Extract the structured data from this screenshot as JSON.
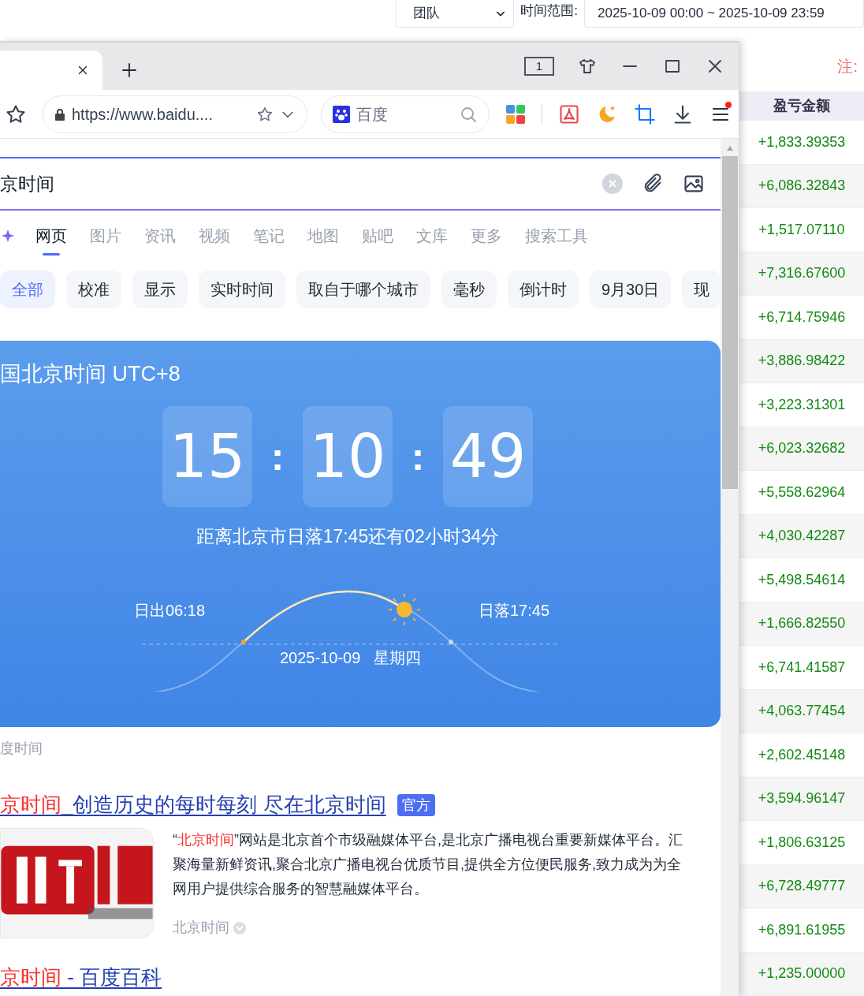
{
  "page_header": {
    "group_select": "团队",
    "time_range_label": "时间范围:",
    "time_range": "2025-10-09 00:00 ~ 2025-10-09 23:59"
  },
  "note": "注:",
  "table": {
    "columns": [
      "盈亏金额"
    ],
    "rows": [
      [
        "+1,833.39353"
      ],
      [
        "+6,086.32843"
      ],
      [
        "+1,517.07110"
      ],
      [
        "+7,316.67600"
      ],
      [
        "+6,714.75946"
      ],
      [
        "+3,886.98422"
      ],
      [
        "+3,223.31301"
      ],
      [
        "+6,023.32682"
      ],
      [
        "+5,558.62964"
      ],
      [
        "+4,030.42287"
      ],
      [
        "+5,498.54614"
      ],
      [
        "+1,666.82550"
      ],
      [
        "+6,741.41587"
      ],
      [
        "+4,063.77454"
      ],
      [
        "+2,602.45148"
      ],
      [
        "+3,594.96147"
      ],
      [
        "+1,806.63125"
      ],
      [
        "+6,728.49777"
      ],
      [
        "+6,891.61955"
      ],
      [
        "+1,235.00000"
      ]
    ]
  },
  "browser": {
    "tab_count": "1",
    "address": "https://www.baidu....",
    "search_engine": "百度",
    "query": "京时间",
    "tabs": [
      {
        "label": "网页",
        "selected": true
      },
      {
        "label": "图片",
        "selected": false
      },
      {
        "label": "资讯",
        "selected": false
      },
      {
        "label": "视频",
        "selected": false
      },
      {
        "label": "笔记",
        "selected": false
      },
      {
        "label": "地图",
        "selected": false
      },
      {
        "label": "贴吧",
        "selected": false
      },
      {
        "label": "文库",
        "selected": false
      },
      {
        "label": "更多",
        "selected": false
      },
      {
        "label": "搜索工具",
        "selected": false
      }
    ],
    "chips": [
      {
        "label": "全部",
        "selected": true
      },
      {
        "label": "校准",
        "selected": false
      },
      {
        "label": "显示",
        "selected": false
      },
      {
        "label": "实时时间",
        "selected": false
      },
      {
        "label": "取自于哪个城市",
        "selected": false
      },
      {
        "label": "毫秒",
        "selected": false
      },
      {
        "label": "倒计时",
        "selected": false
      },
      {
        "label": "9月30日",
        "selected": false
      },
      {
        "label": "现",
        "selected": false
      }
    ],
    "clock": {
      "title": "国北京时间 UTC+8",
      "hours": "15",
      "minutes": "10",
      "seconds": "49",
      "separator": ":",
      "sunset_countdown": "距离北京市日落17:45还有02小时34分",
      "sunrise": "日出06:18",
      "sunset": "日落17:45",
      "date": "2025-10-09",
      "weekday": "星期四",
      "source": "度时间"
    },
    "results": [
      {
        "title_highlight": "京时间",
        "title_rest": "_创造历史的每时每刻 尽在北京时间",
        "badge": "官方",
        "snippet_open": "“",
        "snippet_highlight": "北京时间",
        "snippet_rest": "”网站是北京首个市级融媒体平台,是北京广播电视台重要新媒体平台。汇聚海量新鲜资讯,聚合北京广播电视台优质节目,提供全方位便民服务,致力成为为全网用户提供综合服务的智慧融媒体平台。",
        "source": "北京时间"
      },
      {
        "title_highlight": "京时间",
        "title_rest": " - 百度百科"
      }
    ]
  }
}
